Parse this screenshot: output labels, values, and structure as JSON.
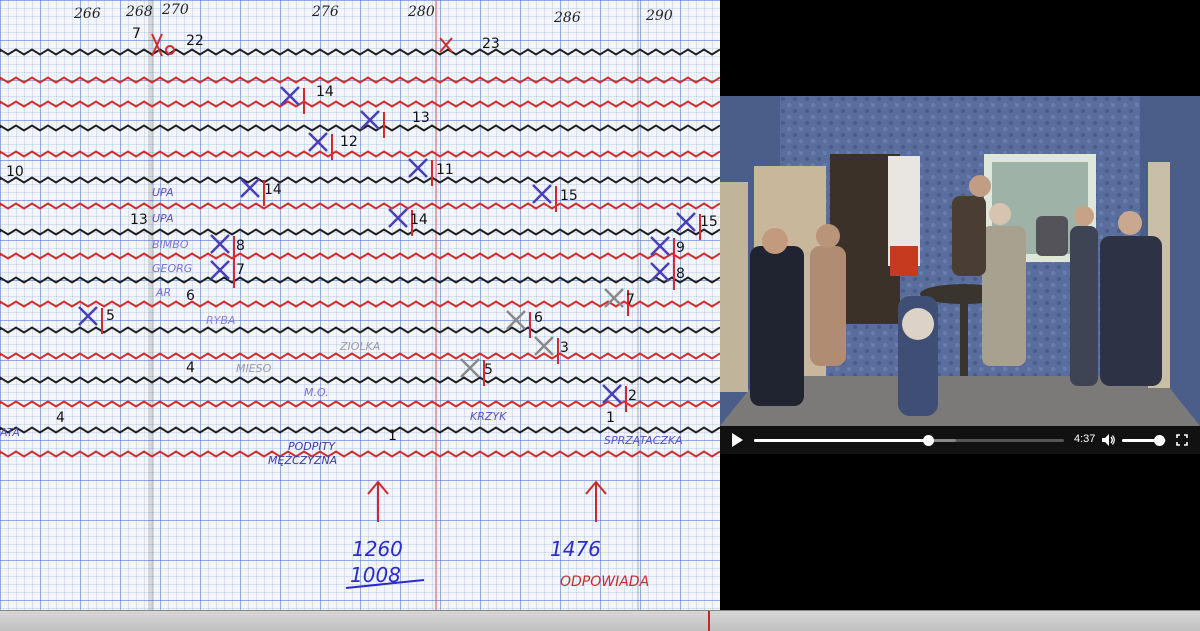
{
  "score": {
    "column_ticks": [
      "266",
      "268",
      "270",
      "276",
      "280",
      "286",
      "290"
    ],
    "top_marks": [
      "7",
      "22",
      "23"
    ],
    "voice_numbers": [
      "14",
      "12",
      "13",
      "11",
      "10",
      "14",
      "13",
      "14",
      "15",
      "15",
      "8",
      "9",
      "7",
      "8",
      "6",
      "7",
      "5",
      "6",
      "3",
      "4",
      "5",
      "2",
      "4",
      "1",
      "1"
    ],
    "pen_labels": {
      "zupa_1": "UPA",
      "zupa_2": "UPA",
      "s1": "BIMBO",
      "s2": "GEORG",
      "s3": "AR",
      "ryba": "RYBA",
      "ziolka": "ZIOLKA",
      "mieso": "MIESO",
      "mo": "M.O.",
      "ata": "ATA",
      "krzyk": "KRZYK"
    },
    "annotations": {
      "left_line1": "PODPITY",
      "left_line2": "MĘŻCZYZNA",
      "right": "SPRZĄTACZKA",
      "left_count": "1260",
      "left_count_2": "1008",
      "right_count": "1476",
      "right_bottom": "ODPOWIADA"
    },
    "colors": {
      "red": "#d42a2a",
      "black": "#1f1f1f",
      "blue_pen": "#4a3fb8",
      "arrow": "#cc2a2a"
    }
  },
  "player": {
    "time": "4:37",
    "progress": 0.56,
    "buffered": 0.65,
    "volume": 0.85,
    "icons": [
      "play-icon",
      "volume-icon",
      "fullscreen-icon"
    ]
  }
}
